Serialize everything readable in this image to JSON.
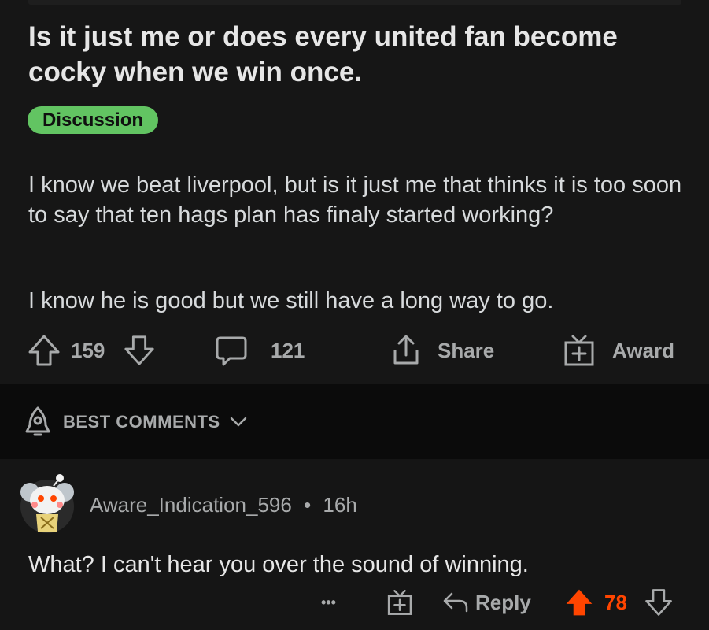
{
  "post": {
    "title": "Is it just me or does every united fan become cocky when we win once.",
    "flair": "Discussion",
    "body_p1": "I know we beat liverpool, but is it just me that thinks it is too soon to say that ten hags plan has finaly started working?",
    "body_p2": "I know he is good but we still have a long way to go.",
    "vote_count": "159",
    "comment_count": "121",
    "share_label": "Share",
    "award_label": "Award",
    "flair_color": "#62c462"
  },
  "sort": {
    "label": "BEST COMMENTS"
  },
  "comment": {
    "author": "Aware_Indication_596",
    "separator": "•",
    "time": "16h",
    "text": "What? I can't hear you over the sound of winning.",
    "more_label": "•••",
    "reply_label": "Reply",
    "vote_count": "78",
    "upvote_color": "#ff4500"
  },
  "icons": [
    "arrow-up-icon",
    "arrow-down-icon",
    "comment-icon",
    "share-icon",
    "gift-icon",
    "rocket-icon",
    "chevron-down-icon",
    "more-icon",
    "reply-icon"
  ]
}
